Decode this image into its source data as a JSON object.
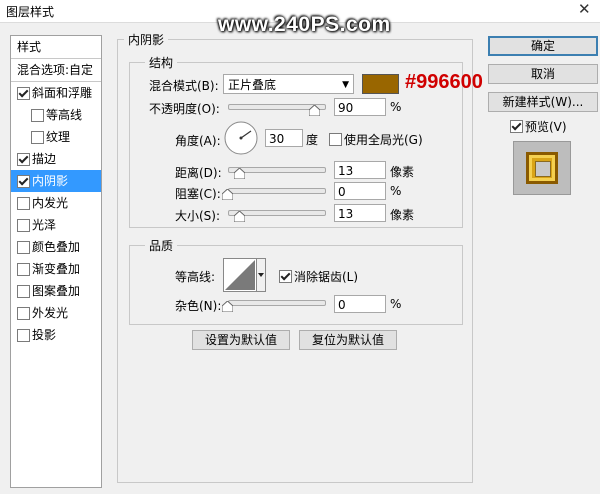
{
  "window": {
    "title": "图层样式",
    "close_glyph": "✕"
  },
  "watermark": "www.240PS.com",
  "sidebar": {
    "header": "样式",
    "blend_options": "混合选项:自定",
    "items": [
      {
        "label": "斜面和浮雕",
        "checked": true,
        "indent": false
      },
      {
        "label": "等高线",
        "checked": false,
        "indent": true
      },
      {
        "label": "纹理",
        "checked": false,
        "indent": true
      },
      {
        "label": "描边",
        "checked": true,
        "indent": false
      },
      {
        "label": "内阴影",
        "checked": true,
        "indent": false,
        "selected": true
      },
      {
        "label": "内发光",
        "checked": false,
        "indent": false
      },
      {
        "label": "光泽",
        "checked": false,
        "indent": false
      },
      {
        "label": "颜色叠加",
        "checked": false,
        "indent": false
      },
      {
        "label": "渐变叠加",
        "checked": false,
        "indent": false
      },
      {
        "label": "图案叠加",
        "checked": false,
        "indent": false
      },
      {
        "label": "外发光",
        "checked": false,
        "indent": false
      },
      {
        "label": "投影",
        "checked": false,
        "indent": false
      }
    ]
  },
  "panel": {
    "title": "内阴影",
    "structure": {
      "title": "结构",
      "blend_mode_label": "混合模式(B):",
      "blend_mode_value": "正片叠底",
      "color_annotation": "#996600",
      "color": "#996600",
      "opacity_label": "不透明度(O):",
      "opacity_value": "90",
      "opacity_unit": "%",
      "opacity_level": 0.9,
      "angle_label": "角度(A):",
      "angle_value": "30",
      "angle_unit": "度",
      "global_light_label": "使用全局光(G)",
      "global_light_checked": false,
      "distance_label": "距离(D):",
      "distance_value": "13",
      "distance_unit": "像素",
      "choke_label": "阻塞(C):",
      "choke_value": "0",
      "choke_unit": "%",
      "size_label": "大小(S):",
      "size_value": "13",
      "size_unit": "像素"
    },
    "quality": {
      "title": "品质",
      "contour_label": "等高线:",
      "antialias_label": "消除锯齿(L)",
      "antialias_checked": true,
      "noise_label": "杂色(N):",
      "noise_value": "0",
      "noise_unit": "%"
    },
    "buttons": {
      "make_default": "设置为默认值",
      "reset_default": "复位为默认值"
    }
  },
  "actions": {
    "ok": "确定",
    "cancel": "取消",
    "new_style": "新建样式(W)...",
    "preview_label": "预览(V)",
    "preview_checked": true
  }
}
